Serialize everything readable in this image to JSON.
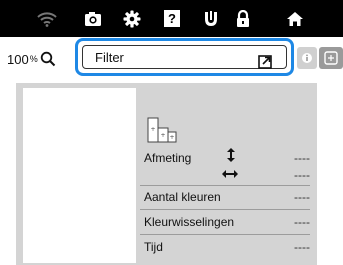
{
  "topbar": {
    "icons": [
      "wifi-icon",
      "camera-icon",
      "gear-icon",
      "help-icon",
      "stitch-icon",
      "lock-icon",
      "home-icon"
    ],
    "help_glyph": "?"
  },
  "toolbar": {
    "zoom_value": "100",
    "zoom_unit": "%",
    "filter_label": "Filter"
  },
  "info": {
    "size_label": "Afmeting",
    "size_height_value": "----",
    "size_width_value": "----",
    "colors_label": "Aantal kleuren",
    "colors_value": "----",
    "color_changes_label": "Kleurwisselingen",
    "color_changes_value": "----",
    "time_label": "Tijd",
    "time_value": "----"
  },
  "colors": {
    "accent": "#1e88e5",
    "topbar_bg": "#000000",
    "panel_bg": "#d4d4d4"
  }
}
